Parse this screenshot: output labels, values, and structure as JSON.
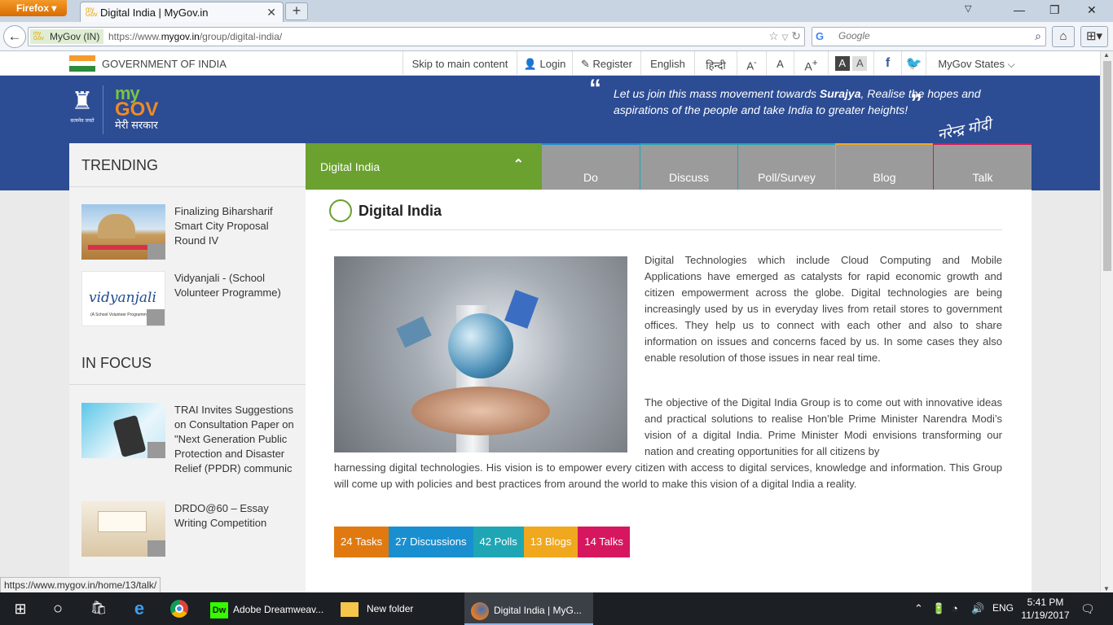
{
  "browser": {
    "app_button": "Firefox",
    "tab_title": "Digital India | MyGov.in",
    "identity": "MyGov (IN)",
    "url_prefix": "https://www.",
    "url_domain": "mygov.in",
    "url_path": "/group/digital-india/",
    "search_engine": "G",
    "search_placeholder": "Google"
  },
  "govbar": {
    "gov_text": "GOVERNMENT OF INDIA",
    "skip": "Skip to main content",
    "login": "Login",
    "register": "Register",
    "english": "English",
    "hindi": "हिन्दी",
    "font_decrease": "A",
    "font_normal": "A",
    "font_increase": "A",
    "contrast_dark": "A",
    "contrast_light": "A",
    "states": "MyGov States"
  },
  "banner": {
    "logo_my": "my",
    "logo_gov": "GOV",
    "logo_hindi": "मेरी सरकार",
    "emblem_text": "सत्यमेव जयते",
    "quote_line1_pre": "Let us join this mass movement towards ",
    "quote_bold": "Surajya",
    "quote_line1_post": ", Realise the hopes and",
    "quote_line2": "aspirations of the people and take India to greater heights!",
    "signature": "नरेन्द्र मोदी"
  },
  "sidebar": {
    "trending_heading": "TRENDING",
    "trending": [
      {
        "title": "Finalizing Biharsharif Smart City Proposal Round IV"
      },
      {
        "title": "Vidyanjali - (School Volunteer Programme)"
      }
    ],
    "focus_heading": "IN FOCUS",
    "focus": [
      {
        "title": "TRAI Invites Suggestions on Consultation Paper on \"Next Generation Public Protection and Disaster Relief (PPDR) communic"
      },
      {
        "title": "DRDO@60 – Essay Writing Competition"
      }
    ],
    "vidyanjali_logo": "vidyanjali",
    "vidyanjali_sub": "(A School Volunteer Programme)"
  },
  "tabs": {
    "active": "Digital India",
    "items": [
      "Do",
      "Discuss",
      "Poll/Survey",
      "Blog",
      "Talk"
    ],
    "colors": [
      "#1a8fd0",
      "#1fa6b4",
      "#1fa6b4",
      "#f0a81e",
      "#d6175f"
    ]
  },
  "content": {
    "title": "Digital India",
    "para1": "Digital Technologies which include Cloud Computing and Mobile Applications have emerged as catalysts for rapid economic growth and citizen empowerment across the globe. Digital technologies are being increasingly used by us in everyday lives from retail stores to government offices. They help us to connect with each other and also to share information on issues and concerns faced by us. In some cases they also enable resolution of those issues in near real time.",
    "para2a": "The objective of the Digital India Group is to come out with innovative ideas and practical solutions to realise Hon’ble Prime Minister Narendra Modi’s vision of a digital India. Prime Minister Modi envisions transforming our nation and creating opportunities for all citizens by",
    "para2b": "harnessing digital technologies. His vision is to empower every citizen with access to digital services, knowledge and information. This Group will come up with policies and best practices from around the world to make this vision of a digital India a reality.",
    "stats": [
      {
        "label": "24 Tasks",
        "color": "#e07a10"
      },
      {
        "label": "27 Discussions",
        "color": "#1a8fd0"
      },
      {
        "label": "42 Polls",
        "color": "#1fa6b4"
      },
      {
        "label": "13 Blogs",
        "color": "#f0a81e"
      },
      {
        "label": "14 Talks",
        "color": "#d6175f"
      }
    ]
  },
  "status_link": "https://www.mygov.in/home/13/talk/",
  "taskbar": {
    "dreamweaver": "Adobe Dreamweav...",
    "dw_icon": "Dw",
    "folder": "New folder",
    "firefox": "Digital India | MyG...",
    "lang": "ENG",
    "time": "5:41 PM",
    "date": "11/19/2017"
  }
}
